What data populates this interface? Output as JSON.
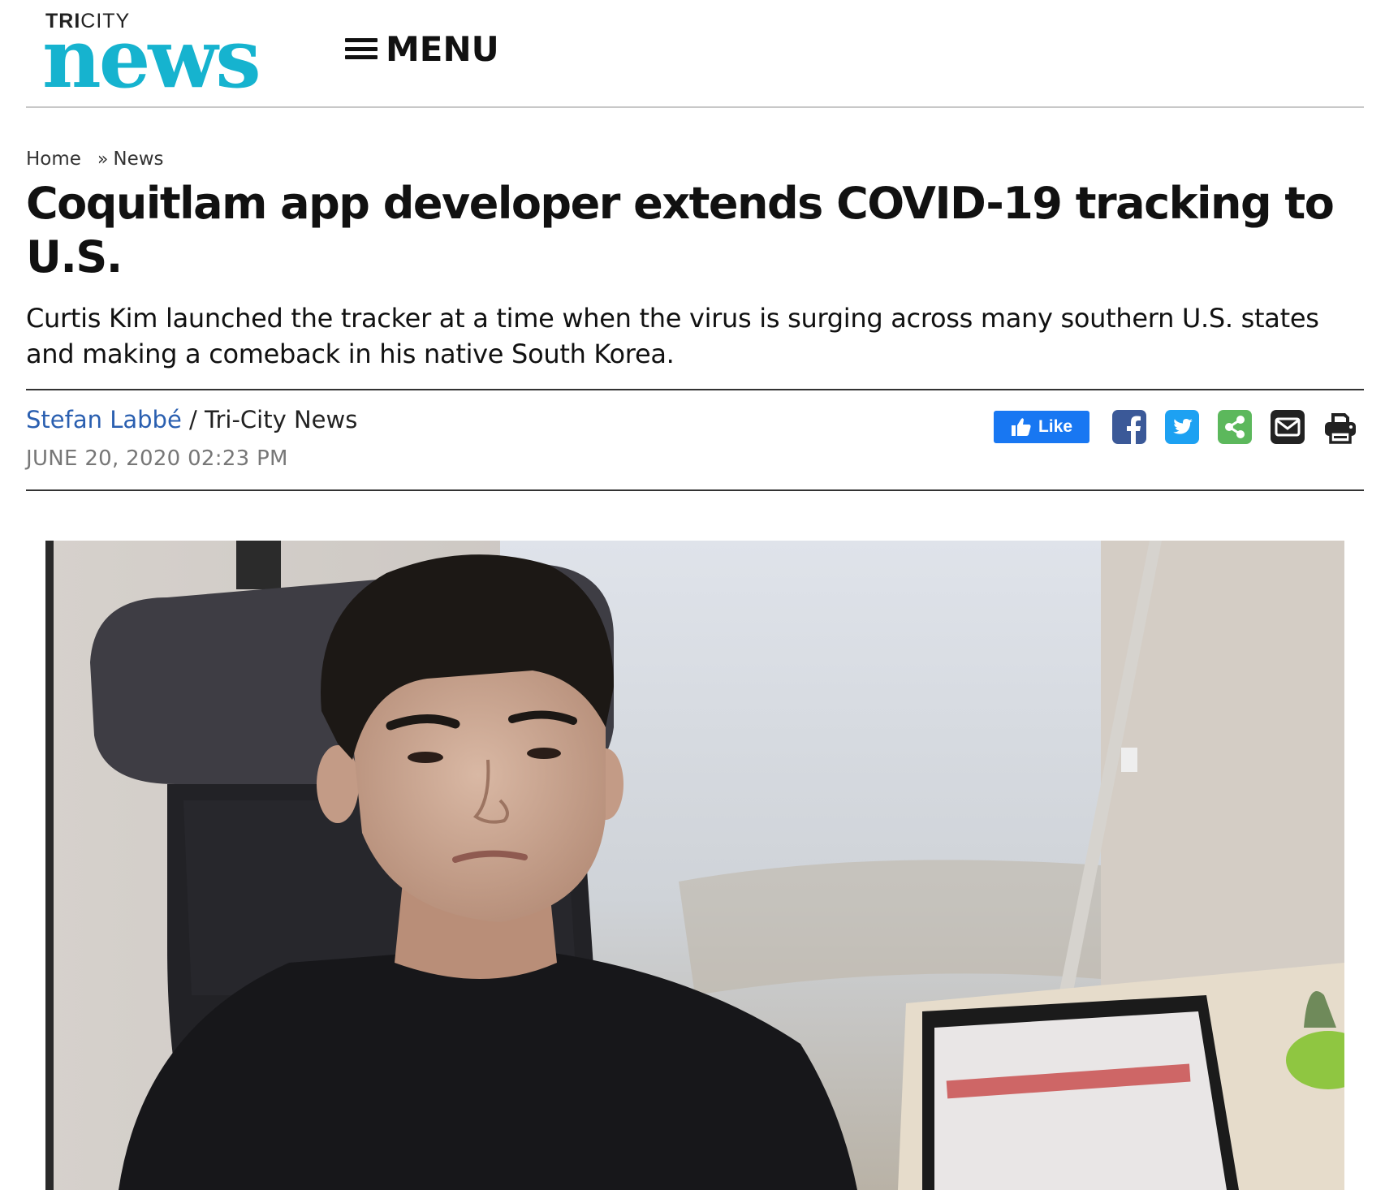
{
  "site": {
    "logo_top_bold": "TRI",
    "logo_top_light": "CITY",
    "logo_main": "news",
    "menu_label": "MENU"
  },
  "breadcrumb": {
    "home": "Home",
    "separator": "»",
    "section": "News"
  },
  "article": {
    "headline": "Coquitlam app developer extends COVID-19 tracking to U.S.",
    "subhead": "Curtis Kim launched the tracker at a time when the virus is surging across many southern U.S. states and making a comeback in his native South Korea.",
    "author": "Stefan Labbé",
    "byline_separator": " / ",
    "publication": "Tri-City News",
    "date": "JUNE 20, 2020 02:23 PM"
  },
  "share": {
    "like_label": "Like",
    "icons": [
      "thumbs-up-icon",
      "facebook-icon",
      "twitter-icon",
      "share-icon",
      "email-icon",
      "print-icon"
    ]
  },
  "colors": {
    "brand": "#16b3cf",
    "author_link": "#2a5fb0",
    "facebook_like": "#1877f2",
    "facebook": "#3b5998",
    "twitter": "#1da1f2",
    "share": "#5cb85c",
    "email": "#222222",
    "print": "#222222"
  },
  "photo": {
    "image": "portrait-photo"
  }
}
